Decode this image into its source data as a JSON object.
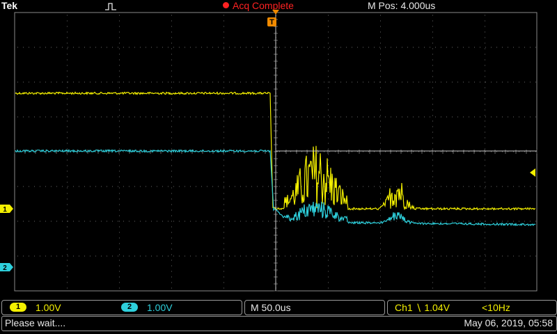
{
  "header": {
    "brand": "Tek",
    "acquisition_status": "Acq Complete",
    "horizontal_position": "M Pos: 4.000us"
  },
  "colors": {
    "ch1": "#f4f000",
    "ch2": "#2ed0dc",
    "acq": "#ff2222",
    "grid": "#6a6a6a"
  },
  "markers": {
    "trigger": "T",
    "ch1": "1",
    "ch2": "2",
    "trigger_level_icon": "trigger-level-arrow-icon"
  },
  "channel_readouts": {
    "ch1_chip": "1",
    "ch1_scale": "1.00V",
    "ch2_chip": "2",
    "ch2_scale": "1.00V",
    "timebase": "M 50.0us",
    "trigger_info": "Ch1 ∖ 1.04V",
    "frequency": "<10Hz"
  },
  "status": {
    "message": "Please wait....",
    "datetime": "May 06, 2019, 05:58"
  }
}
